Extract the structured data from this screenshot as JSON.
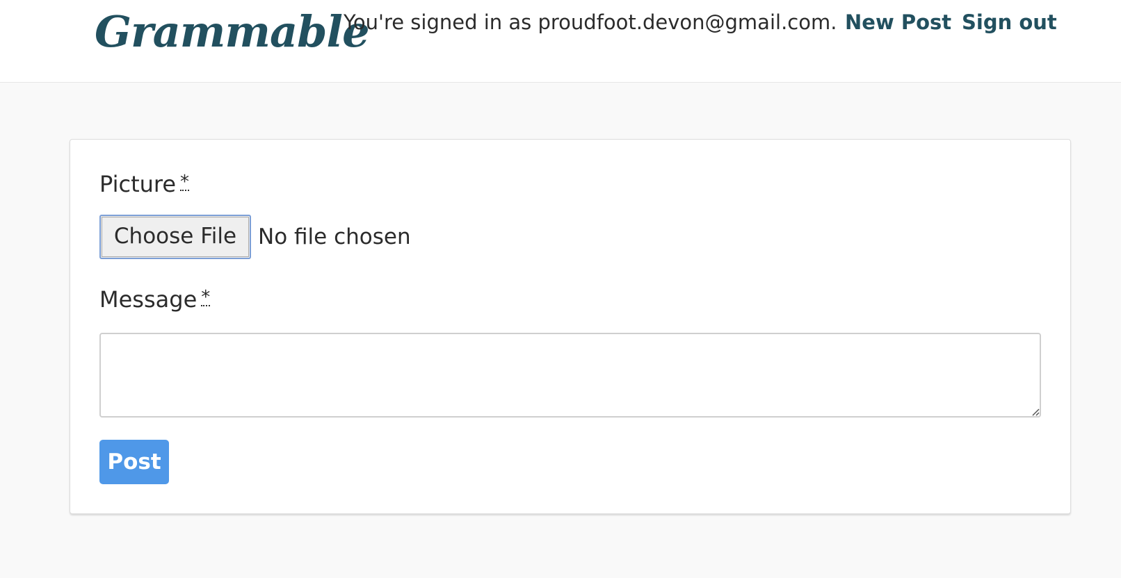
{
  "header": {
    "logo_text": "Grammable",
    "signed_in_text": "You're signed in as proudfoot.devon@gmail.com.",
    "new_post_label": "New Post",
    "sign_out_label": "Sign out"
  },
  "form": {
    "picture_label": "Picture",
    "picture_required_marker": "*",
    "choose_file_label": "Choose File",
    "file_status": "No file chosen",
    "message_label": "Message",
    "message_required_marker": "*",
    "message_value": "",
    "submit_label": "Post"
  },
  "colors": {
    "brand": "#22505f",
    "primary_button": "#4f98e8",
    "page_background": "#f9f9f9"
  }
}
